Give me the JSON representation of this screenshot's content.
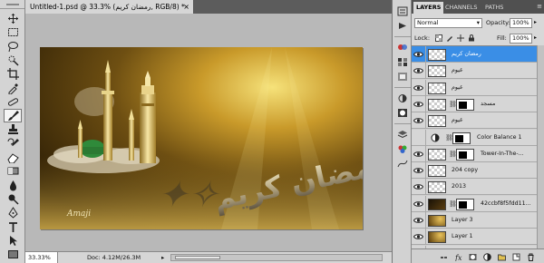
{
  "document": {
    "tab_title": "Untitled-1.psd @ 33.3% (رمضان كريم, RGB/8) *",
    "close_glyph": "×",
    "zoom": "33.33%",
    "doc_size": "Doc: 4.12M/26.3M",
    "status_arrow": "▸",
    "artwork_text": "رمضان كريم",
    "signature": "Amaji"
  },
  "toolbar": {
    "tools": [
      "move-tool",
      "marquee-tool",
      "lasso-tool",
      "quick-select-tool",
      "crop-tool",
      "eyedropper-tool",
      "healing-brush-tool",
      "brush-tool",
      "clone-stamp-tool",
      "history-brush-tool",
      "eraser-tool",
      "gradient-tool",
      "blur-tool",
      "dodge-tool",
      "pen-tool",
      "type-tool",
      "path-select-tool",
      "shape-tool"
    ]
  },
  "panel": {
    "tabs": {
      "layers": "LAYERS",
      "channels": "CHANNELS",
      "paths": "PATHS"
    },
    "menu_glyph": "≡",
    "blend_mode": "Normal",
    "opacity_label": "Opacity:",
    "opacity_value": "100%",
    "lock_label": "Lock:",
    "fill_label": "Fill:",
    "fill_value": "100%",
    "layers": [
      {
        "name": "رمضان كريم",
        "visible": true,
        "selected": true,
        "thumb": "checker",
        "mask": false
      },
      {
        "name": "غيوم",
        "visible": true,
        "selected": false,
        "thumb": "checker",
        "mask": false
      },
      {
        "name": "غيوم",
        "visible": true,
        "selected": false,
        "thumb": "checker",
        "mask": false
      },
      {
        "name": "مسجد",
        "visible": true,
        "selected": false,
        "thumb": "checker",
        "mask": true
      },
      {
        "name": "غيوم",
        "visible": true,
        "selected": false,
        "thumb": "checker",
        "mask": false
      },
      {
        "name": "Color Balance 1",
        "visible": false,
        "selected": false,
        "thumb": "adjust",
        "mask": true
      },
      {
        "name": "Tower-In-The-...",
        "visible": true,
        "selected": false,
        "thumb": "checker",
        "mask": true
      },
      {
        "name": "204 copy",
        "visible": true,
        "selected": false,
        "thumb": "checker",
        "mask": false
      },
      {
        "name": "2013",
        "visible": true,
        "selected": false,
        "thumb": "checker",
        "mask": false
      },
      {
        "name": "42ccbf8f5fdd11...",
        "visible": true,
        "selected": false,
        "thumb": "dark",
        "mask": true
      },
      {
        "name": "Layer 3",
        "visible": true,
        "selected": false,
        "thumb": "gold",
        "mask": false
      },
      {
        "name": "Layer 1",
        "visible": true,
        "selected": false,
        "thumb": "gold",
        "mask": false
      },
      {
        "name": "3",
        "visible": true,
        "selected": false,
        "thumb": "gold",
        "mask": false
      }
    ],
    "bottom_icons": [
      "link-layers-icon",
      "layer-style-icon",
      "add-mask-icon",
      "adjustment-layer-icon",
      "new-group-icon",
      "new-layer-icon",
      "trash-icon"
    ]
  },
  "colors": {
    "selection": "#3a8ee6",
    "panel_bg": "#d8d8d8",
    "artwork_gold": "#c9a133"
  }
}
